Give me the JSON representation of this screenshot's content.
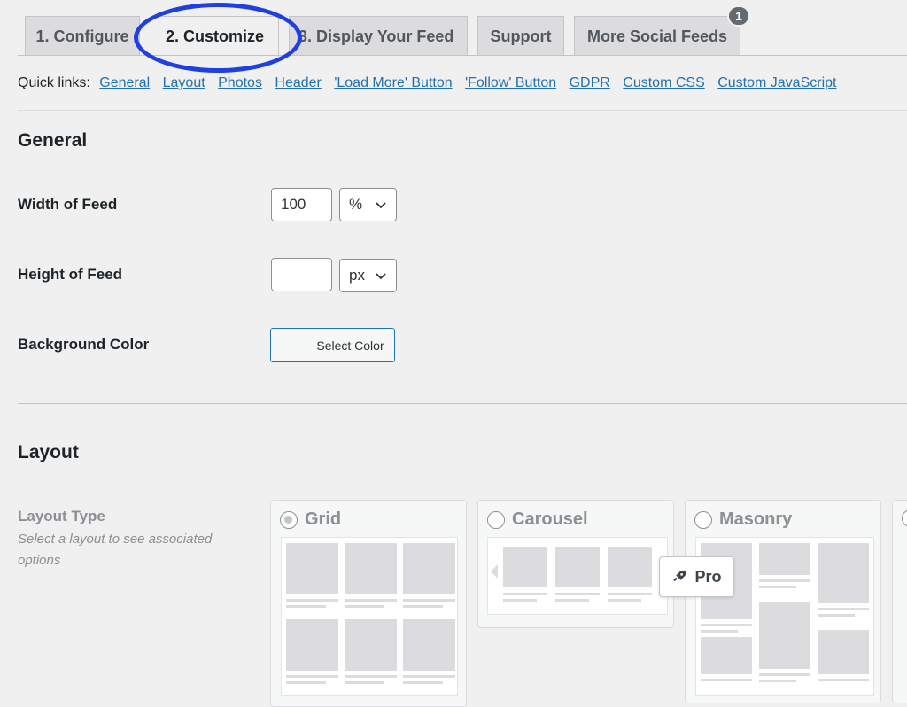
{
  "tabs": [
    {
      "label": "1. Configure",
      "active": false
    },
    {
      "label": "2. Customize",
      "active": true
    },
    {
      "label": "3. Display Your Feed",
      "active": false
    },
    {
      "label": "Support",
      "active": false
    },
    {
      "label": "More Social Feeds",
      "active": false,
      "badge": "1"
    }
  ],
  "quick_links": {
    "label": "Quick links:",
    "links": [
      "General",
      "Layout",
      "Photos",
      "Header",
      "'Load More' Button",
      "'Follow' Button",
      "GDPR",
      "Custom CSS",
      "Custom JavaScript"
    ]
  },
  "general": {
    "title": "General",
    "width": {
      "label": "Width of Feed",
      "value": "100",
      "unit": "%"
    },
    "height": {
      "label": "Height of Feed",
      "value": "",
      "unit": "px"
    },
    "background": {
      "label": "Background Color",
      "button": "Select Color"
    }
  },
  "layout": {
    "title": "Layout",
    "type_label": "Layout Type",
    "type_desc": "Select a layout to see associated options",
    "options": [
      {
        "label": "Grid",
        "selected": true
      },
      {
        "label": "Carousel",
        "selected": false
      },
      {
        "label": "Masonry",
        "selected": false
      }
    ],
    "pro_label": "Pro"
  },
  "colors": {
    "link": "#2271b1",
    "highlight": "#1f3fe0",
    "muted": "#8c8f94"
  },
  "icons": {
    "select_chevron": "chevron-down-icon",
    "pro": "rocket-icon"
  }
}
